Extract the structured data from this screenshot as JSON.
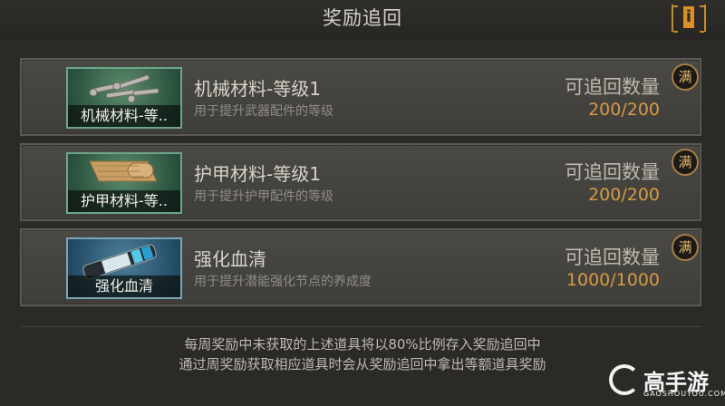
{
  "header": {
    "title": "奖励追回",
    "info_button": "i"
  },
  "items": [
    {
      "thumb_label": "机械材料-等..",
      "name": "机械材料-等级1",
      "description": "用于提升武器配件的等级",
      "quantity_label": "可追回数量",
      "quantity_value": "200/200",
      "badge": "满",
      "icon": "bolts-icon"
    },
    {
      "thumb_label": "护甲材料-等..",
      "name": "护甲材料-等级1",
      "description": "用于提升护甲配件的等级",
      "quantity_label": "可追回数量",
      "quantity_value": "200/200",
      "badge": "满",
      "icon": "cloth-roll-icon"
    },
    {
      "thumb_label": "强化血清",
      "name": "强化血清",
      "description": "用于提升潜能强化节点的养成度",
      "quantity_label": "可追回数量",
      "quantity_value": "1000/1000",
      "badge": "满",
      "icon": "serum-vial-icon"
    }
  ],
  "notice": {
    "line1": "每周奖励中未获取的上述道具将以80%比例存入奖励追回中",
    "line2": "通过周奖励获取相应道具时会从奖励追回中拿出等额道具奖励"
  },
  "watermark": {
    "name": "高手游",
    "domain": "GAOSHOUYOU.COM"
  },
  "colors": {
    "accent": "#c98a2c",
    "quantity": "#d69a43",
    "thumb_border": "#6da58c"
  }
}
